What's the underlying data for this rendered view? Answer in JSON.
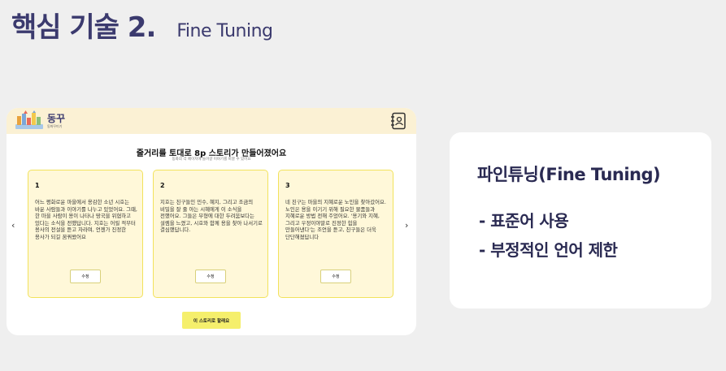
{
  "slide": {
    "title": "핵심 기술 2.",
    "subtitle": "Fine Tuning"
  },
  "app": {
    "logo_name": "동꾸",
    "logo_tagline": "동화꾸미기",
    "heading": "줄거리를 토대로 8p 스토리가 만들어졌어요",
    "subheading": "동화의 각 페이지에 들어갈 이야기를 바꿀 수 있어요",
    "cards": [
      {
        "number": "1",
        "text": "어느 평화로운 마을에서 용감한 소년 시호는 바운 사람들과 이야기를 나누고 있었어요. 그때, 한 마을 사람이 용이 나타나 땅국을 위협하고 있다는 소식을 전했답니다. 지호는 어릴 적부터 용사의 전설을 듣고 자라며, 언젠가 진정한 용사가 되길 꿈꿔왔어요",
        "edit_label": "수정"
      },
      {
        "number": "2",
        "text": "지호는 친구들인 민수, 혜지, 그리고 조금의 비밀을 잘 줄 아는 시혜에게 이 소식을 전했어요. 그들은 무형에 대한 두려움보다는 설렘을 느꼈고, 시호와 함께 용을 찾아 나서기로 결심했답니다.",
        "edit_label": "수정"
      },
      {
        "number": "3",
        "text": "네 친구는 마을의 지혜로운 노인을 찾아갔어요. 노인은 용을 이기기 위해 필요한 물품들과 지혜로운 방법 전해 주었어요. '용기와 지혜, 그리고 우정이야말로 진정한 힘을 만들어낸다'는 조언을 듣고, 친구들은 더욱 단단해졌답니다",
        "edit_label": "수정"
      }
    ],
    "prev_arrow": "‹",
    "next_arrow": "›",
    "make_button": "이 스토리로 할래요"
  },
  "panel": {
    "title": "파인튜닝(Fine Tuning)",
    "bullets": [
      "- 표준어 사용",
      "- 부정적인 언어 제한"
    ]
  },
  "colors": {
    "title_navy": "#3b3a6e",
    "header_cream": "#fbf1d4",
    "card_fill": "#fff8d9",
    "card_border": "#f2e25c",
    "button_yellow": "#f5ef6c"
  },
  "icons": [
    "book-logo-icon",
    "contacts-book-icon",
    "chevron-left-icon",
    "chevron-right-icon"
  ]
}
